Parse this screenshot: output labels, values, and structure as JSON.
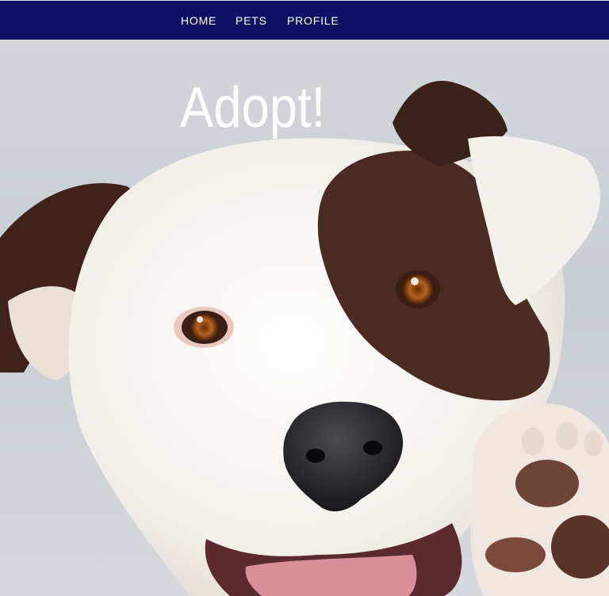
{
  "nav": {
    "items": [
      {
        "label": "HOME"
      },
      {
        "label": "PETS"
      },
      {
        "label": "PROFILE"
      }
    ],
    "background": "#0f0f63",
    "text_color": "#ffffff"
  },
  "hero": {
    "title": "Adopt!",
    "title_color": "#ffffff",
    "image": "dog-photo"
  }
}
